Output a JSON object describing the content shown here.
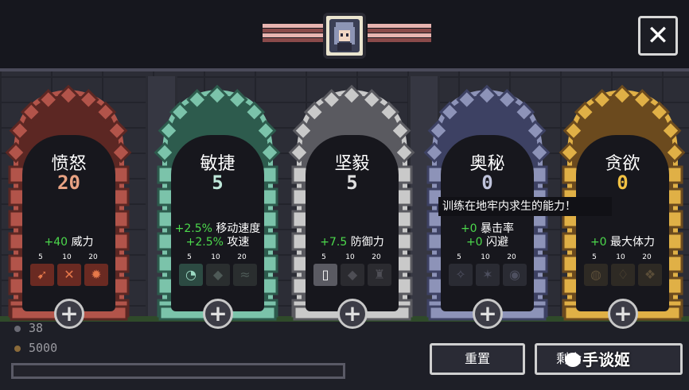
{
  "header": {
    "close_label": "✕",
    "ribbon_colors": {
      "light": "#e8b4b0",
      "dark": "#8a4a4a"
    }
  },
  "attributes": [
    {
      "name": "愤怒",
      "level": "20",
      "level_color": "#e8a283",
      "frame_color": "#b2544a",
      "frame_dark": "#5c2723",
      "bonuses": [
        {
          "value": "+40",
          "label": "威力"
        }
      ],
      "tier_labels": [
        "5",
        "10",
        "20"
      ],
      "skills": [
        {
          "icon": "arrow-slash-icon",
          "glyph": "➹",
          "color": "#e6784a",
          "bg": "#6a2a22"
        },
        {
          "icon": "chevron-claw-icon",
          "glyph": "✕",
          "color": "#e6784a",
          "bg": "#6a2a22"
        },
        {
          "icon": "flame-icon",
          "glyph": "✹",
          "color": "#e6784a",
          "bg": "#6a2a22"
        }
      ]
    },
    {
      "name": "敏捷",
      "level": "5",
      "level_color": "#bfe8da",
      "frame_color": "#7bc3aa",
      "frame_dark": "#2d5b4d",
      "bonuses": [
        {
          "value": "+2.5%",
          "label": "移动速度"
        },
        {
          "value": "+2.5%",
          "label": "攻速"
        }
      ],
      "tier_labels": [
        "5",
        "10",
        "20"
      ],
      "skills": [
        {
          "icon": "swirl-icon",
          "glyph": "◔",
          "color": "#9bd9c2",
          "bg": "#2c4a42"
        },
        {
          "icon": "blade-icon",
          "glyph": "◆",
          "color": "#4e5a57",
          "bg": "#2a2e2f"
        },
        {
          "icon": "wind-icon",
          "glyph": "≈",
          "color": "#4e5a57",
          "bg": "#2a2e2f"
        }
      ]
    },
    {
      "name": "坚毅",
      "level": "5",
      "level_color": "#e0e0e0",
      "frame_color": "#c9c9c9",
      "frame_dark": "#5a5a60",
      "bonuses": [
        {
          "value": "+7.5",
          "label": "防御力"
        }
      ],
      "tier_labels": [
        "5",
        "10",
        "20"
      ],
      "skills": [
        {
          "icon": "shield-card-icon",
          "glyph": "▯",
          "color": "#ffffff",
          "bg": "#5a5a62"
        },
        {
          "icon": "blade-icon",
          "glyph": "◆",
          "color": "#4e4e55",
          "bg": "#2b2b30"
        },
        {
          "icon": "armor-icon",
          "glyph": "♜",
          "color": "#4e4e55",
          "bg": "#2b2b30"
        }
      ]
    },
    {
      "name": "奥秘",
      "level": "0",
      "level_color": "#c0c4dc",
      "frame_color": "#8d93b8",
      "frame_dark": "#3d4163",
      "bonuses": [
        {
          "value": "+0",
          "label": "暴击率"
        },
        {
          "value": "+0",
          "label": "闪避"
        }
      ],
      "tier_labels": [
        "5",
        "10",
        "20"
      ],
      "skills": [
        {
          "icon": "rune-icon",
          "glyph": "✧",
          "color": "#4e5060",
          "bg": "#2a2b33"
        },
        {
          "icon": "star-burst-icon",
          "glyph": "✶",
          "color": "#4e5060",
          "bg": "#2a2b33"
        },
        {
          "icon": "eye-icon",
          "glyph": "◉",
          "color": "#4e5060",
          "bg": "#2a2b33"
        }
      ]
    },
    {
      "name": "贪欲",
      "level": "0",
      "level_color": "#f2c244",
      "frame_color": "#e0b046",
      "frame_dark": "#6b4a1e",
      "bonuses": [
        {
          "value": "+0",
          "label": "最大体力"
        }
      ],
      "tier_labels": [
        "5",
        "10",
        "20"
      ],
      "skills": [
        {
          "icon": "coin-icon",
          "glyph": "◍",
          "color": "#5a4d38",
          "bg": "#2e2a24"
        },
        {
          "icon": "bag-icon",
          "glyph": "♢",
          "color": "#5a4d38",
          "bg": "#2e2a24"
        },
        {
          "icon": "gem-icon",
          "glyph": "❖",
          "color": "#5a4d38",
          "bg": "#2e2a24"
        }
      ]
    }
  ],
  "tooltip": {
    "text": "训练在地牢内求生的能力！"
  },
  "resources": {
    "top_value": "38",
    "gold_value": "5000",
    "progress": 0.0
  },
  "buttons": {
    "reset_label": "重置",
    "remaining_label": "剩余"
  },
  "watermark": {
    "text": "手谈姬"
  }
}
